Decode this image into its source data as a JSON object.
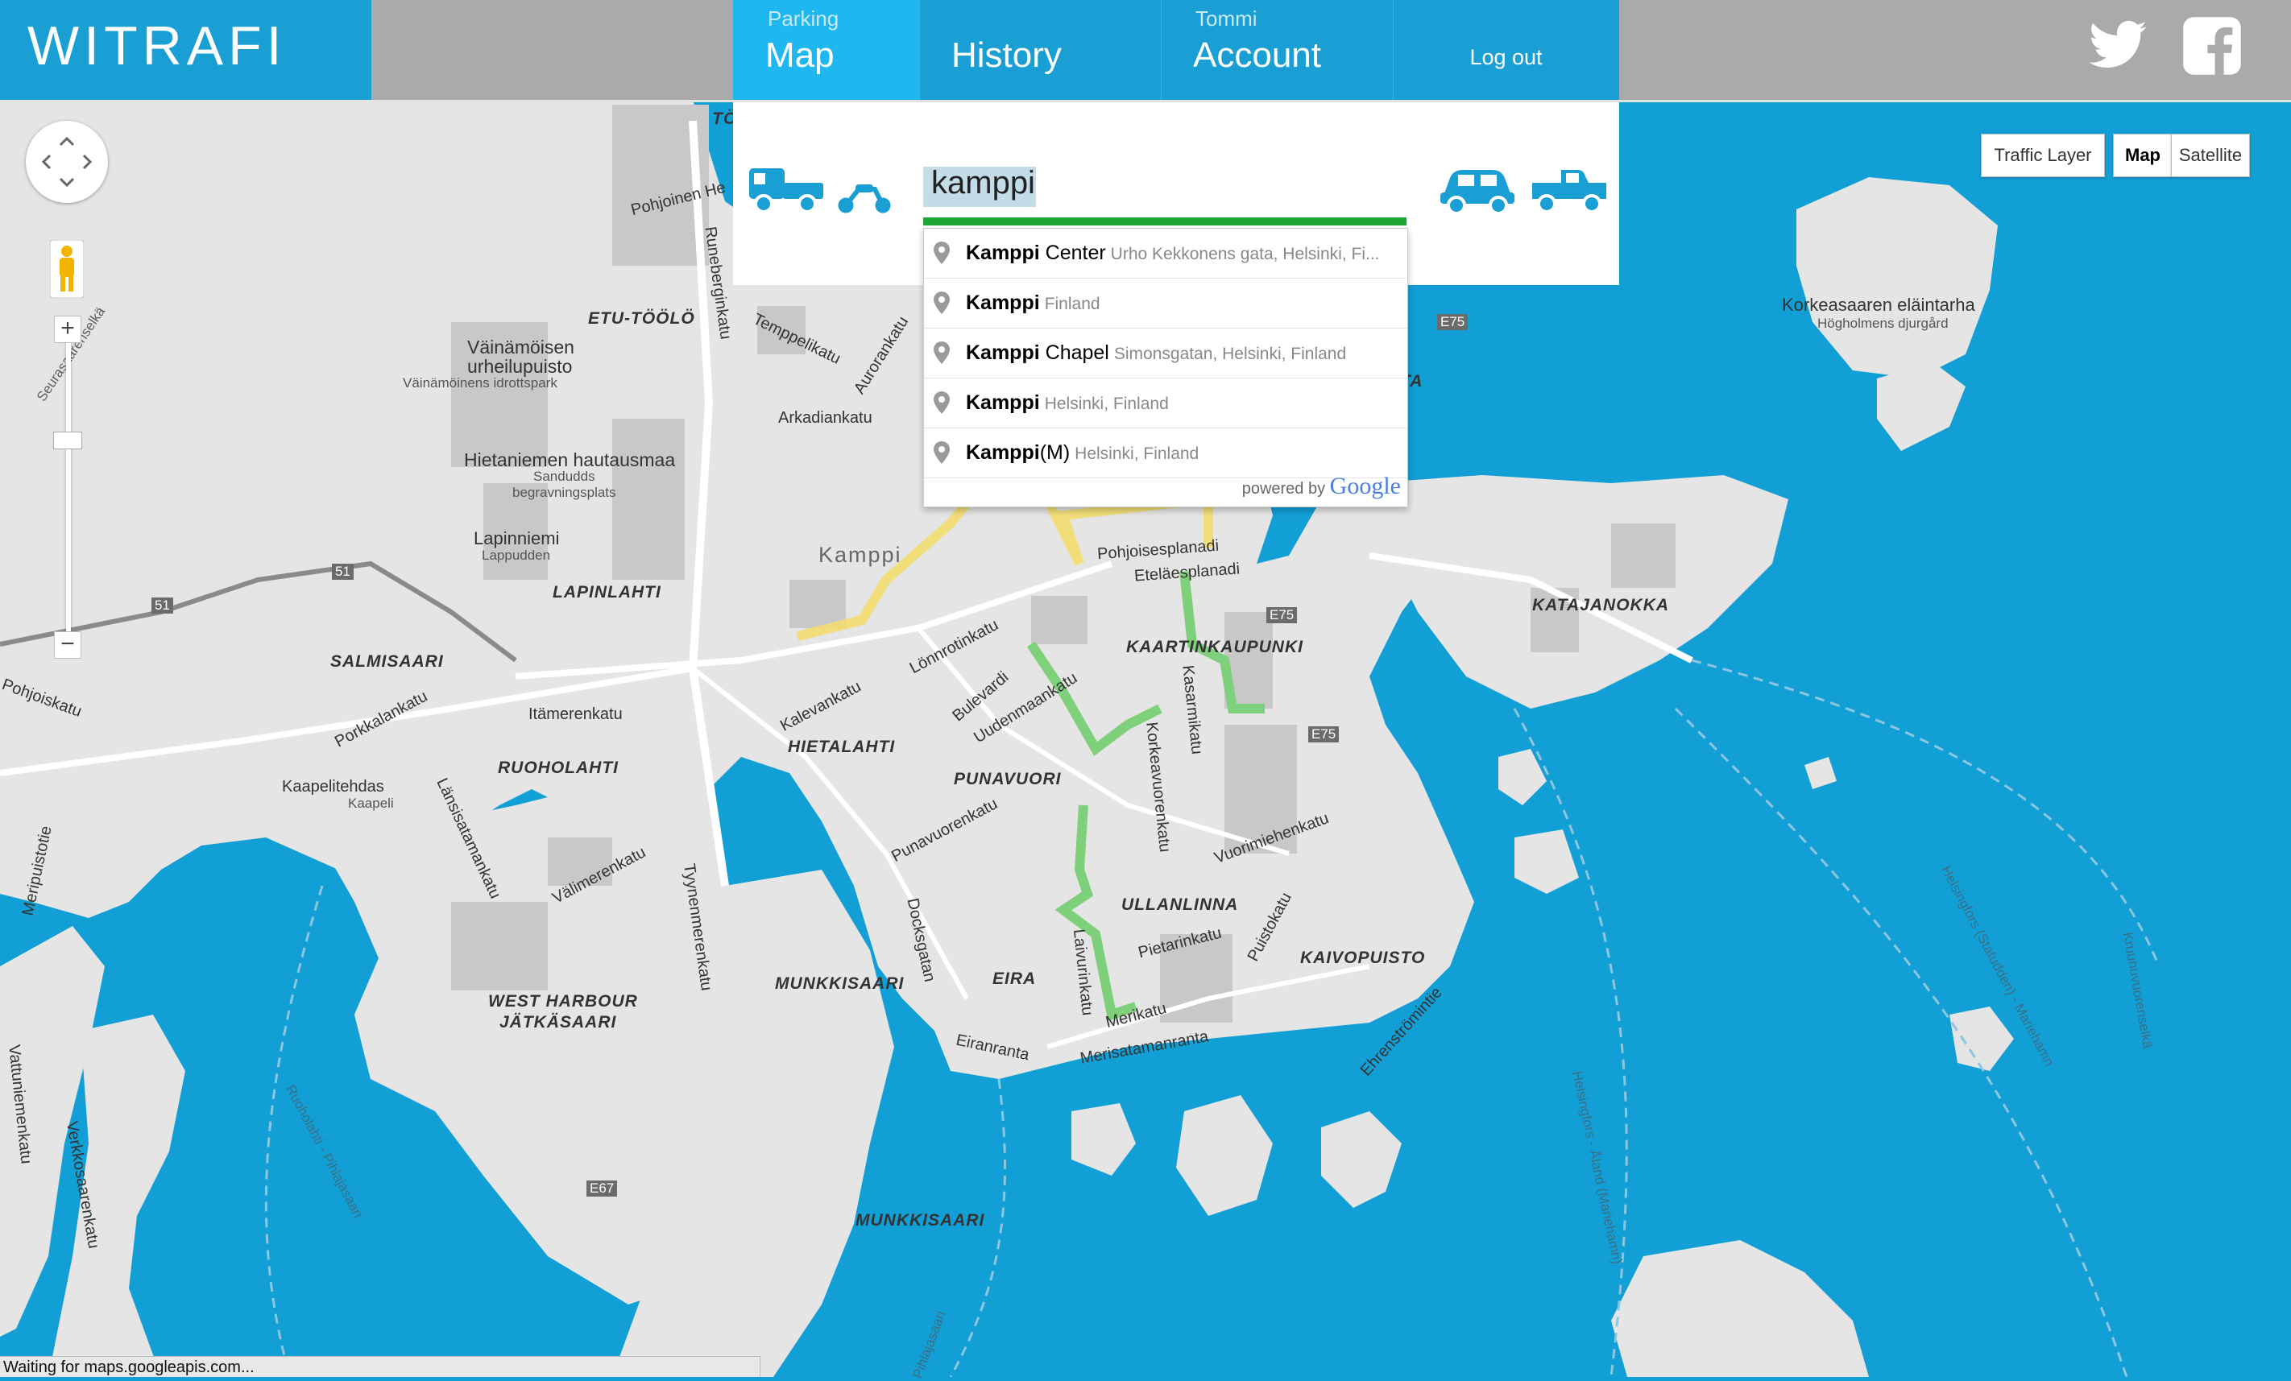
{
  "app": {
    "logo": "WITRAFI"
  },
  "nav": {
    "map": {
      "sub": "Parking",
      "label": "Map"
    },
    "history": {
      "label": "History"
    },
    "account": {
      "sub": "Tommi",
      "label": "Account"
    },
    "logout": {
      "label": "Log out"
    }
  },
  "social": {
    "twitter": "twitter-icon",
    "facebook": "facebook-icon"
  },
  "search": {
    "value": "kamppi",
    "vehicles_left": [
      "truck-icon",
      "motorcycle-icon"
    ],
    "vehicles_right": [
      "car-icon",
      "pickup-icon"
    ],
    "colors": {
      "accent": "#1a9fd5",
      "underline": "#1da633"
    }
  },
  "autocomplete": {
    "items": [
      {
        "main": "Kamppi",
        "rest": " Center",
        "secondary": "Urho Kekkonens gata, Helsinki, Fi..."
      },
      {
        "main": "Kamppi",
        "rest": "",
        "secondary": "Finland"
      },
      {
        "main": "Kamppi",
        "rest": " Chapel",
        "secondary": "Simonsgatan, Helsinki, Finland"
      },
      {
        "main": "Kamppi",
        "rest": "",
        "secondary": "Helsinki, Finland"
      },
      {
        "main": "Kamppi",
        "rest": "(M)",
        "secondary": "Helsinki, Finland"
      }
    ],
    "powered_by": "powered by",
    "google": "Google"
  },
  "map_controls": {
    "zoom_in": "+",
    "zoom_out": "−",
    "traffic_layer": "Traffic Layer",
    "map": "Map",
    "satellite": "Satellite"
  },
  "map_labels": {
    "etu_toolo": "ETU-TÖÖLÖ",
    "vainamoisen": "Väinämöisen",
    "urheilupuisto": "urheilupuisto",
    "vainamoinens": "Väinämöinens idrottspark",
    "hietaniemen": "Hietaniemen hautausmaa",
    "sandudds": "Sandudds",
    "begravningsplats": "begravningsplats",
    "lapinniemi": "Lapinniemi",
    "lappudden": "Lappudden",
    "lapinlahti": "LAPINLAHTI",
    "salmisaari": "SALMISAARI",
    "pohjoiskatu": "Pohjoiskatu",
    "porkkalankatu": "Porkkalankatu",
    "itamerenkatu": "Itämerenkatu",
    "ruoholahti": "RUOHOLAHTI",
    "kaapelitehdas": "Kaapelitehdas",
    "kaapeli": "Kaapeli",
    "lansisatamankatu": "Länsisatamankatu",
    "valimerenkatu": "Välimerenkatu",
    "west_harbour": "WEST HARBOUR",
    "jatkasaari": "JÄTKÄSAARI",
    "meripuistotie": "Meripuistotie",
    "vattuniemenkatu": "Vattuniemenkatu",
    "verkkosaarenkatu": "Verkkosaarenkatu",
    "kamppi": "Kamppi",
    "kalevankatu": "Kalevankatu",
    "lonnrotinkatu": "Lönnrotinkatu",
    "bulevardi": "Bulevardi",
    "uudenmaankatu": "Uudenmaankatu",
    "hietalahti": "HIETALAHTI",
    "punavuori": "PUNAVUORI",
    "punavuorenkatu": "Punavuorenkatu",
    "munkkisaari": "MUNKKISAARI",
    "munkkisaari2": "MUNKKISAARI",
    "eira": "EIRA",
    "eiranranta": "Eiranranta",
    "docksgatan": "Docksgatan",
    "tyynenmerenkatu": "Tyynenmerenkatu",
    "laivurinkatu": "Laivurinkatu",
    "ullanlinna": "ULLANLINNA",
    "pietarinkatu": "Pietarinkatu",
    "merikatu": "Merikatu",
    "merisatamanranta": "Merisatamanranta",
    "korkeavuorenkatu": "Korkeavuorenkatu",
    "kasarmikatu": "Kasarmikatu",
    "kaartinkaupunki": "KAARTINKAUPUNKI",
    "pohjoisesplanadi": "Pohjoisesplanadi",
    "etelaesplanadi": "Eteläesplanadi",
    "vuorimiehenkatu": "Vuorimiehenkatu",
    "puistokatu": "Puistokatu",
    "kaivopuisto": "KAIVOPUISTO",
    "ehrenstromintie": "Ehrenströmintie",
    "katajanokka": "KATAJANOKKA",
    "korkeasaaren": "Korkeasaaren eläintarha",
    "hogholmens": "Högholmens djurgård",
    "runeberginkatu": "Runeberginkatu",
    "temppelikatu": "Temppelikatu",
    "arkadiankatu": "Arkadiankatu",
    "aurorankatu": "Aurorankatu",
    "pohjoinen_he": "Pohjoinen He",
    "to": "TÖ",
    "ta": "TA",
    "e75a": "E75",
    "e75b": "E75",
    "e75c": "E75",
    "e67": "E67",
    "r51a": "51",
    "r51b": "51",
    "seurasaarenselka": "Seurasaarenselkä",
    "helsingfors_statudden": "Helsingfors (Statudden) - Mariehamn",
    "helsingfors_aland": "Helsingfors - Åland (Mariehamn)",
    "ruoholahti_pihlajasaari": "Ruoholahti - Pihlajasaari",
    "kruunuvuorenselka": "Kruunuvuorenselkä",
    "pihlajasaari": "Pihlajasaari"
  },
  "status_bar": "Waiting for maps.googleapis.com..."
}
